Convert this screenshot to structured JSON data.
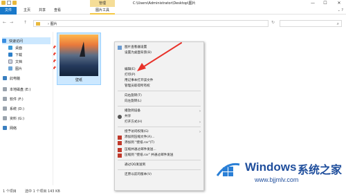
{
  "titlebar": {
    "tool_tab_header": "管理",
    "title_path": "C:\\Users\\Administrator\\Desktop\\图片",
    "minimize": "—",
    "maximize": "☐",
    "close": "✕"
  },
  "ribbon": {
    "tabs": [
      "文件",
      "主页",
      "共享",
      "查看",
      "图片工具"
    ]
  },
  "address": {
    "back": "←",
    "forward": "→",
    "up": "↑",
    "crumb": "› 图片",
    "refresh": "↻",
    "search_icon": "⌕"
  },
  "navpane": {
    "items": [
      {
        "label": "快速访问",
        "icon": "star-icon"
      },
      {
        "label": "桌面",
        "icon": "desktop-icon"
      },
      {
        "label": "下载",
        "icon": "download-icon"
      },
      {
        "label": "文档",
        "icon": "document-icon"
      },
      {
        "label": "图片",
        "icon": "pictures-icon"
      },
      {
        "label": "此电脑",
        "icon": "pc-icon"
      },
      {
        "label": "本地磁盘 (E:)",
        "icon": "drive-icon"
      },
      {
        "label": "软件 (F:)",
        "icon": "drive-icon"
      },
      {
        "label": "系统 (D:)",
        "icon": "drive-icon"
      },
      {
        "label": "资料 (G:)",
        "icon": "drive-icon"
      },
      {
        "label": "网络",
        "icon": "network-icon"
      }
    ],
    "pin": "📌"
  },
  "file": {
    "name": "壁纸"
  },
  "context_menu": {
    "items": [
      {
        "label": "图片查看器设置"
      },
      {
        "label": "设置为桌面背景(B)"
      },
      {
        "label": "编辑(E)"
      },
      {
        "label": "打印(P)"
      },
      {
        "label": "用记事本打开该文件"
      },
      {
        "label": "管理员取得所有权"
      },
      {
        "label": "向右旋转(T)"
      },
      {
        "label": "向左旋转(L)"
      },
      {
        "label": "播放到设备",
        "arrow": "›"
      },
      {
        "label": "共享"
      },
      {
        "label": "打开方式(H)",
        "arrow": "›"
      },
      {
        "label": "授予访问权限(G)",
        "arrow": "›"
      },
      {
        "label": "添加到压缩文件(A)..."
      },
      {
        "label": "添加到 \"壁纸.rar\"(T)"
      },
      {
        "label": "压缩并通过邮件发送..."
      },
      {
        "label": "压缩到 \"壁纸.rar\" 并通过邮件发送"
      },
      {
        "label": "通过QQ发送到"
      },
      {
        "label": "还原以前的版本(V)"
      }
    ]
  },
  "status": {
    "count": "1 个项目",
    "selected": "选中 1 个项目  143 KB"
  },
  "watermark": {
    "title": "Windows",
    "cn": "系统之家",
    "url": "www.bjjmlv.com"
  },
  "colors": {
    "file_tab": "#1979ca",
    "selection": "#cce8ff",
    "arrow": "#e8322a",
    "watermark": "#1f4e9c"
  }
}
